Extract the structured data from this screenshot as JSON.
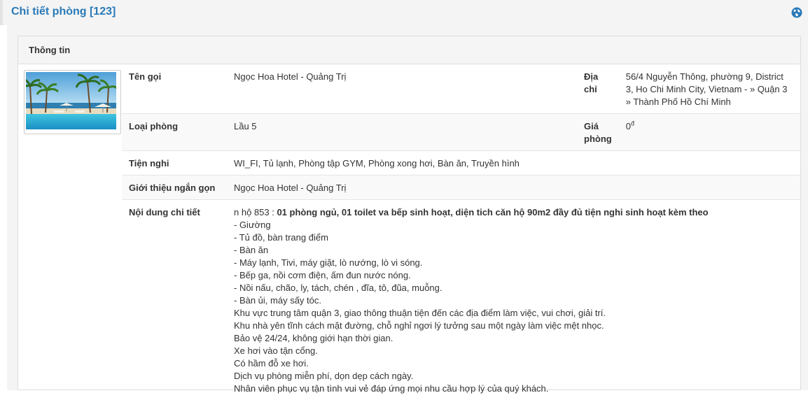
{
  "header": {
    "title": "Chi tiết phòng [123]",
    "icon": "globe-icon",
    "accent_color": "#2a7ab8"
  },
  "panel": {
    "heading": "Thông tin",
    "image_icon": "hotel-beach-photo"
  },
  "info": {
    "name_label": "Tên gọi",
    "name_value": "Ngọc Hoa Hotel - Quảng Trị",
    "address_label_line1": "Địa",
    "address_label_line2": "chỉ",
    "address_value": "56/4 Nguyễn Thông, phường 9, District 3, Ho Chi Minh City, Vietnam - » Quận 3 » Thành Phố Hồ Chí Minh",
    "room_type_label": "Loại phòng",
    "room_type_value": "Lầu 5",
    "price_label_line1": "Giá",
    "price_label_line2": "phòng",
    "price_value": "0",
    "price_currency": "đ",
    "amenities_label": "Tiện nghi",
    "amenities_value": "WI_FI, Tủ lạnh, Phòng tập GYM, Phòng xong hơi, Bàn ăn, Truyền hình",
    "intro_label": "Giới thiệu ngắn gọn",
    "intro_value": "Ngọc Hoa Hotel - Quảng Trị",
    "detail_label": "Nội dung chi tiết",
    "detail_prefix": "n hộ 853 : ",
    "detail_bold": "01 phòng ngủ, 01 toilet va bếp sinh hoạt, diện tich căn hộ 90m2 đầy đủ tiện nghi sinh hoạt kèm theo",
    "detail_lines": [
      "- Giường",
      "- Tủ đồ, bàn trang điểm",
      "- Bàn ăn",
      "- Máy lạnh, Tivi, máy giặt, lò nướng, lò vi sóng.",
      "- Bếp ga, nồi cơm điện, ấm đun nước nóng.",
      "- Nồi nấu, chão, ly, tách, chén , đĩa, tô, đũa, muỗng.",
      "- Bàn ủi, máy sấy tóc.",
      "Khu vực trung tâm quận 3, giao thông thuận tiện đến các địa điểm làm việc, vui chơi, giải trí.",
      "Khu nhà yên tĩnh cách mặt đường, chỗ nghỉ ngơi lý tưởng sau một ngày làm việc mệt nhọc.",
      "Bảo vệ 24/24, không giới hạn thời gian.",
      "Xe hơi vào tận cổng.",
      "Có hầm đỗ xe hơi.",
      "Dịch vụ phòng miễn phí, dọn dẹp cách ngày.",
      "Nhân viên phục vụ tận tình vui vẻ đáp ứng mọi nhu cầu hợp lý của quý  khách."
    ]
  }
}
